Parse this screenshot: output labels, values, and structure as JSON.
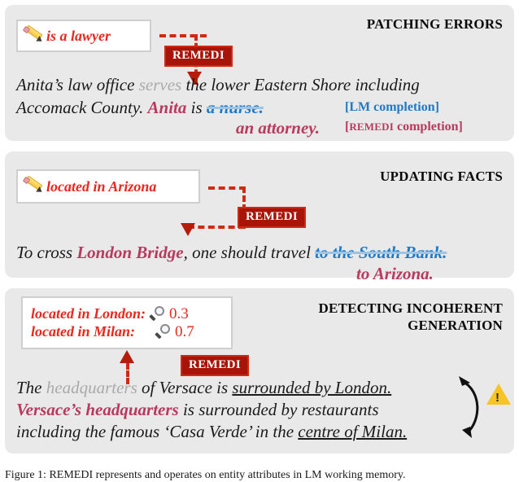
{
  "figure": {
    "caption": "Figure 1: REMEDI represents and operates on entity attributes in LM working memory."
  },
  "panels": [
    {
      "id": "patching-errors",
      "title": "PATCHING ERRORS",
      "edit_icon": "pencil-icon",
      "edit_text": "is a lawyer",
      "badge": "REMEDI",
      "text_line1": {
        "a": "Anita’s law office ",
        "b": "serves",
        "c": " the lower Eastern Shore including"
      },
      "text_line2": {
        "a": "Accomack County. ",
        "b": "Anita",
        "c": " is ",
        "d": "a nurse."
      },
      "text_line3": {
        "a": "an attorney."
      },
      "tag_lm": "[LM completion]",
      "tag_remedi_prefix": "[",
      "tag_remedi_small": "REMEDI",
      "tag_remedi_suffix": " completion]"
    },
    {
      "id": "updating-facts",
      "title": "UPDATING FACTS",
      "edit_icon": "pencil-icon",
      "edit_text": "located in Arizona",
      "badge": "REMEDI",
      "text_line1": {
        "a": "To cross ",
        "b": "London Bridge",
        "c": ", one should travel ",
        "d": "to the South Bank."
      },
      "text_line2": {
        "a": "to Arizona."
      }
    },
    {
      "id": "detecting-incoherent-generation",
      "title_line1": "DETECTING INCOHERENT",
      "title_line2": "GENERATION",
      "facts": [
        {
          "label": "located in London",
          "colon": ":",
          "icon": "magnifier-icon",
          "score": "0.3"
        },
        {
          "label": "located in Milan",
          "colon": ":",
          "icon": "magnifier-icon",
          "score": "0.7"
        }
      ],
      "badge": "REMEDI",
      "text_line1": {
        "a": "The ",
        "b": "headquarters",
        "c": " of Versace is ",
        "d": "surrounded by London."
      },
      "text_line2": {
        "a": "Versace’s headquarters",
        "b": " is surrounded by restaurants"
      },
      "text_line3": {
        "a": "including the famous ‘Casa Verde’ in the ",
        "b": "centre of Milan."
      },
      "warning_icon": "warning-triangle-icon",
      "warning_glyph": "!"
    }
  ],
  "colors": {
    "panel_bg": "#e9e9e9",
    "edit_red": "#e8281e",
    "badge_bg": "#a81408",
    "badge_border": "#cf2a14",
    "lm_blue": "#2079c4",
    "remedi_maroon": "#b83a5e",
    "gray_token": "#aaaaaa",
    "warning_yellow": "#f7c325"
  }
}
